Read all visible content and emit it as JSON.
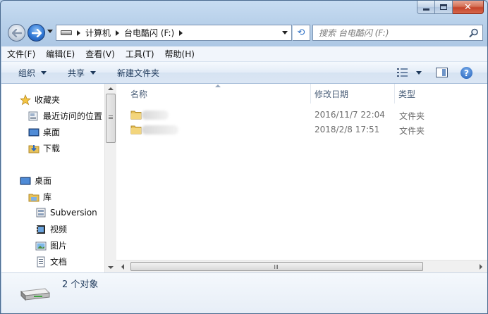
{
  "window": {
    "controls": {
      "minimize_icon": "minimize-icon",
      "maximize_icon": "maximize-icon",
      "close_icon": "close-icon",
      "close_glyph": "✕"
    }
  },
  "navigation": {
    "address_segments": [
      "计算机",
      "台电酷闪 (F:)"
    ],
    "refresh_glyph": "⟲",
    "search_placeholder": "搜索 台电酷闪 (F:)"
  },
  "menu": {
    "items": [
      "文件(F)",
      "编辑(E)",
      "查看(V)",
      "工具(T)",
      "帮助(H)"
    ]
  },
  "toolbar": {
    "organize_label": "组织",
    "share_label": "共享",
    "new_folder_label": "新建文件夹",
    "help_glyph": "?"
  },
  "nav_pane": {
    "favorites": {
      "label": "收藏夹",
      "items": [
        "最近访问的位置",
        "桌面",
        "下载"
      ]
    },
    "desktop": {
      "label": "桌面",
      "library": {
        "label": "库",
        "items": [
          "Subversion",
          "视频",
          "图片",
          "文档"
        ]
      }
    }
  },
  "file_list": {
    "columns": {
      "name": "名称",
      "date": "修改日期",
      "type": "类型"
    },
    "rows": [
      {
        "date": "2016/11/7 22:04",
        "type": "文件夹"
      },
      {
        "date": "2018/2/8 17:51",
        "type": "文件夹"
      }
    ]
  },
  "details": {
    "count_text": "2 个对象"
  },
  "colors": {
    "accent": "#1e395b",
    "frame": "#b9d1ea",
    "folder": "#e8c25a"
  }
}
